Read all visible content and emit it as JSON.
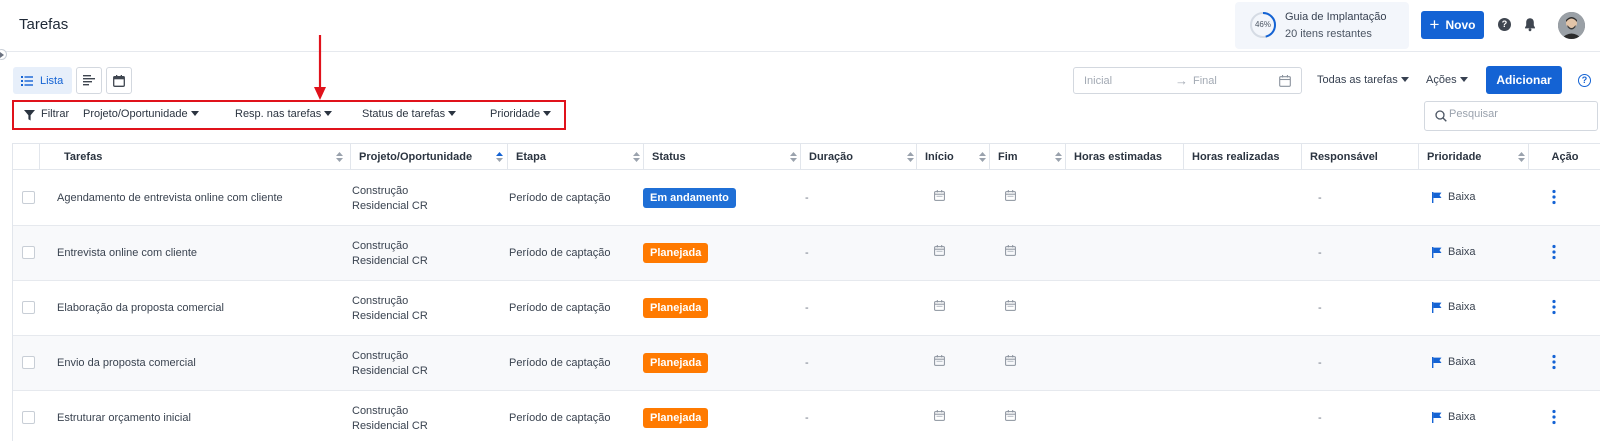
{
  "header": {
    "title": "Tarefas",
    "guide": {
      "percent_label": "46%",
      "progress": 0.46,
      "title": "Guia de Implantação",
      "subtitle": "20 itens restantes"
    },
    "new_button": {
      "icon": "plus-icon",
      "label": "Novo"
    },
    "help_icon": "?",
    "bell_icon": "bell-icon"
  },
  "toolbar": {
    "views": [
      {
        "name": "list-view",
        "icon": "list-icon",
        "label": "Lista",
        "active": true
      },
      {
        "name": "gantt-view",
        "icon": "gantt-icon"
      },
      {
        "name": "calendar-view",
        "icon": "calendar-icon"
      }
    ],
    "date_start_placeholder": "Inicial",
    "date_end_placeholder": "Final",
    "all_tasks_label": "Todas as tarefas",
    "actions_label": "Ações",
    "add_button_label": "Adicionar",
    "help_icon": "?"
  },
  "filters": {
    "label": "Filtrar",
    "items": [
      "Projeto/Oportunidade",
      "Resp. nas tarefas",
      "Status de tarefas",
      "Prioridade"
    ],
    "search_placeholder": "Pesquisar"
  },
  "table": {
    "columns": [
      "Tarefas",
      "Projeto/Oportunidade",
      "Etapa",
      "Status",
      "Duração",
      "Início",
      "Fim",
      "Horas estimadas",
      "Horas realizadas",
      "Responsável",
      "Prioridade",
      "Ação"
    ],
    "rows": [
      {
        "task": "Agendamento de entrevista online com cliente",
        "project_line1": "Construção",
        "project_line2": "Residencial CR",
        "stage": "Período de captação",
        "status": "Em andamento",
        "status_color": "#1f6fd6",
        "duration": "-",
        "responsible": "-",
        "priority": "Baixa"
      },
      {
        "task": "Entrevista online com cliente",
        "project_line1": "Construção",
        "project_line2": "Residencial CR",
        "stage": "Período de captação",
        "status": "Planejada",
        "status_color": "#ff7a00",
        "duration": "-",
        "responsible": "-",
        "priority": "Baixa"
      },
      {
        "task": "Elaboração da proposta comercial",
        "project_line1": "Construção",
        "project_line2": "Residencial CR",
        "stage": "Período de captação",
        "status": "Planejada",
        "status_color": "#ff7a00",
        "duration": "-",
        "responsible": "-",
        "priority": "Baixa"
      },
      {
        "task": "Envio da proposta comercial",
        "project_line1": "Construção",
        "project_line2": "Residencial CR",
        "stage": "Período de captação",
        "status": "Planejada",
        "status_color": "#ff7a00",
        "duration": "-",
        "responsible": "-",
        "priority": "Baixa"
      },
      {
        "task": "Estruturar orçamento inicial",
        "project_line1": "Construção",
        "project_line2": "Residencial CR",
        "stage": "Período de captação",
        "status": "Planejada",
        "status_color": "#ff7a00",
        "duration": "-",
        "responsible": "-",
        "priority": "Baixa"
      }
    ]
  },
  "colors": {
    "accent": "#1463d4",
    "annotation": "#e0121b",
    "in_progress": "#1f6fd6",
    "planned": "#ff7a00",
    "priority_flag": "#1463d4"
  }
}
